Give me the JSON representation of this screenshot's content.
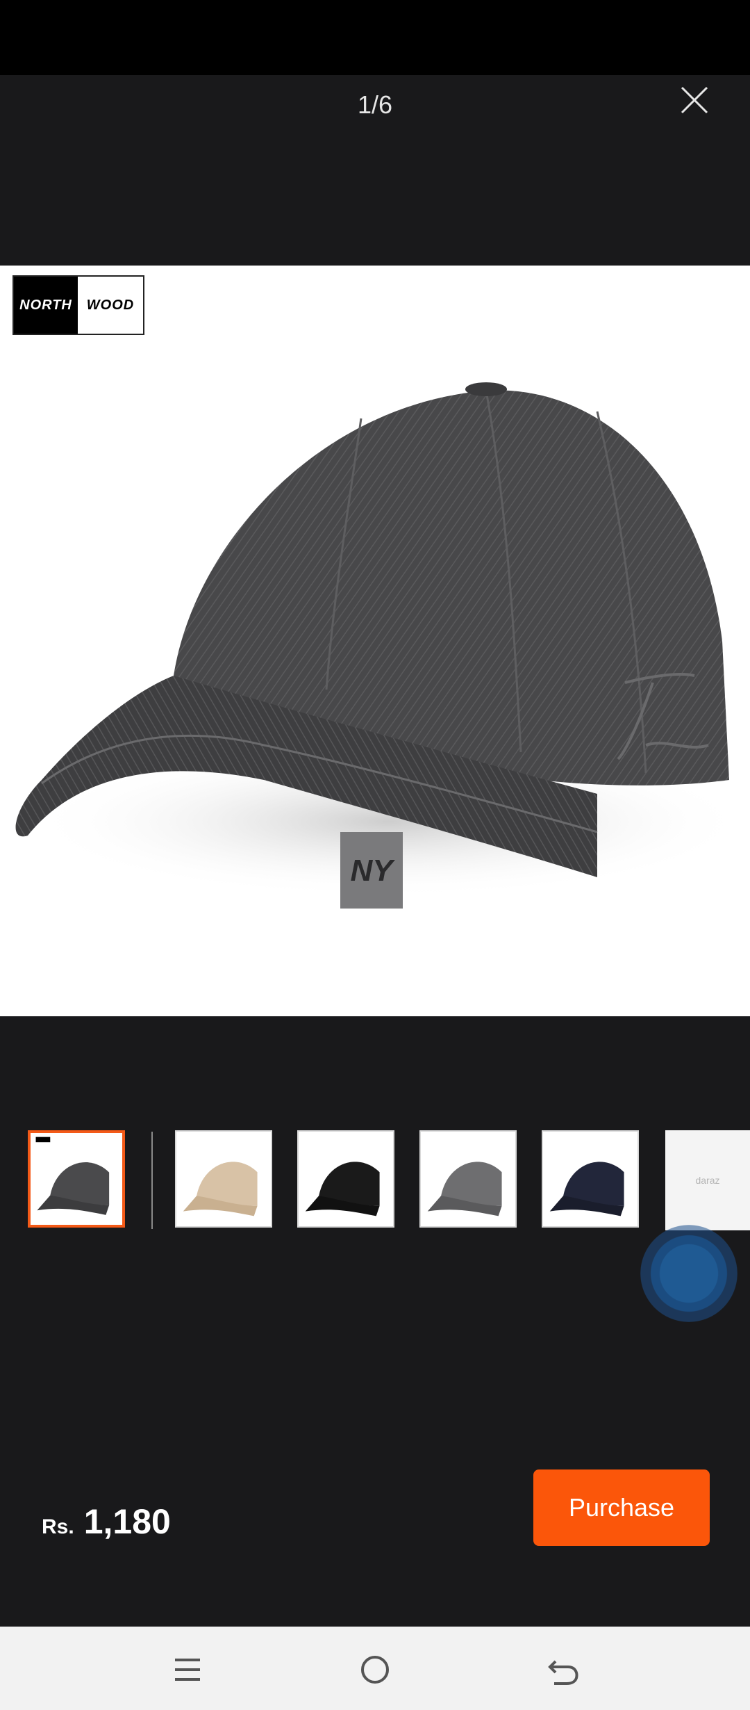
{
  "viewer": {
    "counter": "1/6"
  },
  "product": {
    "brand_left": "NORTH",
    "brand_right": "WOOD",
    "hat_emblem": "NY",
    "side_script": "Travel",
    "thumbnails": [
      {
        "color": "#4a4a4c",
        "label": "dark gray"
      },
      {
        "color": "#d8c2a6",
        "label": "beige"
      },
      {
        "color": "#1a1a1a",
        "label": "black"
      },
      {
        "color": "#6e6e70",
        "label": "gray"
      },
      {
        "color": "#22263a",
        "label": "navy"
      }
    ],
    "thumb_brand": "daraz"
  },
  "footer": {
    "currency": "Rs.",
    "price": "1,180",
    "purchase_label": "Purchase"
  },
  "colors": {
    "accent": "#fb560a",
    "active_border": "#f45a18",
    "background": "#19191b"
  },
  "icons": [
    "close-icon",
    "menu-icon",
    "home-icon",
    "back-icon"
  ]
}
